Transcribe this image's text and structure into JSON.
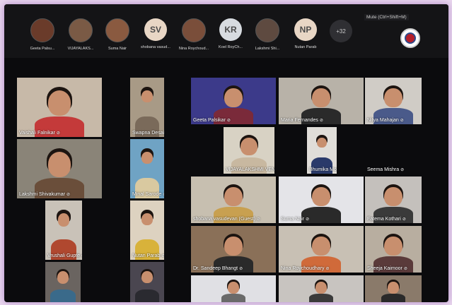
{
  "top_participants": [
    {
      "name": "Geeta Palsu...",
      "initials": "",
      "bg": "#6a3b2a"
    },
    {
      "name": "VIJAYALAKS...",
      "initials": "",
      "bg": "#7a5a45"
    },
    {
      "name": "Suma Nair",
      "initials": "",
      "bg": "#8a5a40"
    },
    {
      "name": "shobana vasud...",
      "initials": "SV",
      "bg": "#e8d6c5"
    },
    {
      "name": "Nina Roychoud...",
      "initials": "",
      "bg": "#7a4e3a"
    },
    {
      "name": "Koel RoyCh...",
      "initials": "KR",
      "bg": "#d7dbe0"
    },
    {
      "name": "Lakshmi Shi...",
      "initials": "",
      "bg": "#5e4a40"
    },
    {
      "name": "Nutan Parab",
      "initials": "NP",
      "bg": "#e8d6c5"
    }
  ],
  "overflow_count": "+32",
  "mute_tooltip": "Mute (Ctrl+Shift+M)",
  "left_tiles": [
    {
      "name": "Vaishali Falnikar",
      "bg": "#c7b9a8",
      "shirt": "#c43a3a"
    },
    {
      "name": "Swapna Desai",
      "bg": "#a89a86",
      "shirt": "#7a6a5a"
    },
    {
      "name": "Lakshmi Shivakumar",
      "bg": "#8a8478",
      "shirt": "#6a4e3a"
    },
    {
      "name": "Minal Sarode",
      "bg": "#6fa3c4",
      "shirt": "#d9c9a0"
    },
    {
      "name": "Vrushali Gupte",
      "bg": "#c9c2b8",
      "shirt": "#b0482f"
    },
    {
      "name": "Nutan Parab",
      "bg": "#ddd2c0",
      "shirt": "#d8b23a"
    },
    {
      "name": "",
      "bg": "#6a6460",
      "shirt": "#3a6a8a"
    },
    {
      "name": "",
      "bg": "#4a4650",
      "shirt": "#2a2a30"
    }
  ],
  "right_tiles": [
    {
      "name": "Geeta Palsikar",
      "bg": "#3c3a8a",
      "shirt": "#7a2a3a"
    },
    {
      "name": "Maria Fernandes",
      "bg": "#b8b2a8",
      "shirt": "#2a2a2a"
    },
    {
      "name": "Nitya Mahajan",
      "bg": "#d0ccc6",
      "shirt": "#4a5a8a"
    },
    {
      "name": "VIJAYALAKSHMI VENKATAC...",
      "bg": "#d8d2c4",
      "shirt": "#c8b8a0"
    },
    {
      "name": "Bhumika More",
      "bg": "#e0ddd8",
      "shirt": "#2a3a6a"
    },
    {
      "name": "Seema Mishra",
      "bg": "#0b0b0d",
      "shirt": "#0b0b0d"
    },
    {
      "name": "shobana vasudevan (Guest)",
      "bg": "#c7bfb0",
      "shirt": "#c8a050"
    },
    {
      "name": "Suma Nair",
      "bg": "#e4e4e8",
      "shirt": "#2a2a2a"
    },
    {
      "name": "Fatema Kothari",
      "bg": "#c4c0bc",
      "shirt": "#3a3a3a"
    },
    {
      "name": "Dr. Sandeep Bhangt",
      "bg": "#8a7058",
      "shirt": "#2a2a2a"
    },
    {
      "name": "Nina Roychoudhary",
      "bg": "#c8c0b4",
      "shirt": "#d06a3a"
    },
    {
      "name": "Sheeja  Kaimoor",
      "bg": "#b8aea0",
      "shirt": "#5a3a3a"
    },
    {
      "name": "",
      "bg": "#e0e0e4",
      "shirt": "#6a6a6a"
    },
    {
      "name": "",
      "bg": "#c8c4c0",
      "shirt": "#3a3a3a"
    },
    {
      "name": "",
      "bg": "#8a7a6a",
      "shirt": "#2a2a2a"
    }
  ]
}
